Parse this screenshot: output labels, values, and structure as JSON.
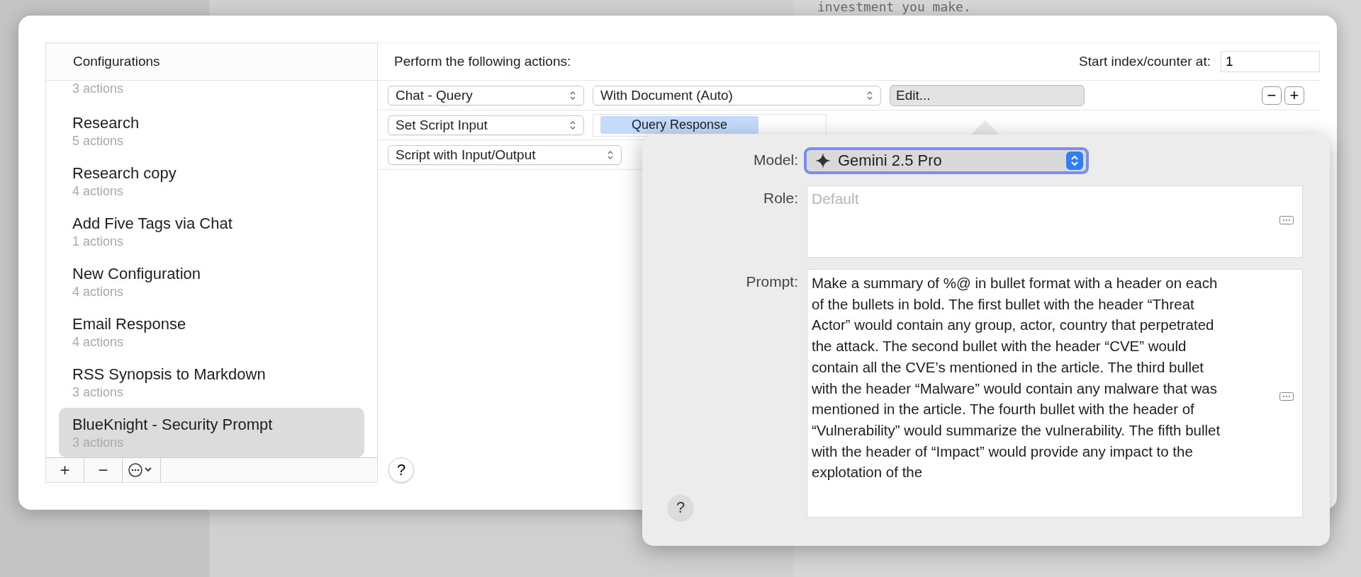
{
  "background": {
    "text": "investment you make."
  },
  "sidebar": {
    "header": "Configurations",
    "items": [
      {
        "subtitle": "3 actions",
        "selected": false
      },
      {
        "title": "Research",
        "subtitle": "5 actions",
        "selected": false
      },
      {
        "title": "Research copy",
        "subtitle": "4 actions",
        "selected": false
      },
      {
        "title": "Add Five Tags via Chat",
        "subtitle": "1 actions",
        "selected": false
      },
      {
        "title": "New Configuration",
        "subtitle": "4 actions",
        "selected": false
      },
      {
        "title": "Email Response",
        "subtitle": "4 actions",
        "selected": false
      },
      {
        "title": "RSS Synopsis to Markdown",
        "subtitle": "3 actions",
        "selected": false
      },
      {
        "title": "BlueKnight - Security Prompt",
        "subtitle": "3 actions",
        "selected": true
      }
    ],
    "buttons": [
      "+",
      "−"
    ]
  },
  "actions": {
    "header": "Perform the following actions:",
    "start_label": "Start index/counter at:",
    "start_value": "1",
    "rows": [
      {
        "kind": "edit",
        "popups": [
          "Chat - Query",
          "With Document (Auto)"
        ],
        "button": "Edit...",
        "row_buttons": [
          "−",
          "+"
        ]
      },
      {
        "kind": "token",
        "popups": [
          "Set Script Input"
        ],
        "token": "Query Response"
      },
      {
        "kind": "plain",
        "popups": [
          "Script with Input/Output"
        ]
      }
    ],
    "help": "?"
  },
  "popover": {
    "model_label": "Model:",
    "model": "Gemini 2.5 Pro",
    "role_label": "Role:",
    "role_placeholder": "Default",
    "prompt_label": "Prompt:",
    "prompt": "Make a summary of %@ in bullet format with a header on each of the bullets in bold. The first bullet with the header “Threat Actor” would contain any group, actor, country that perpetrated the attack. The second bullet with the header “CVE” would contain all the CVE’s mentioned in the article. The third bullet with the header “Malware” would contain any malware that was mentioned in the article. The fourth bullet with the header of “Vulnerability” would summarize the vulnerability. The fifth bullet with the header of “Impact” would provide any impact to the explotation of the",
    "help": "?"
  }
}
